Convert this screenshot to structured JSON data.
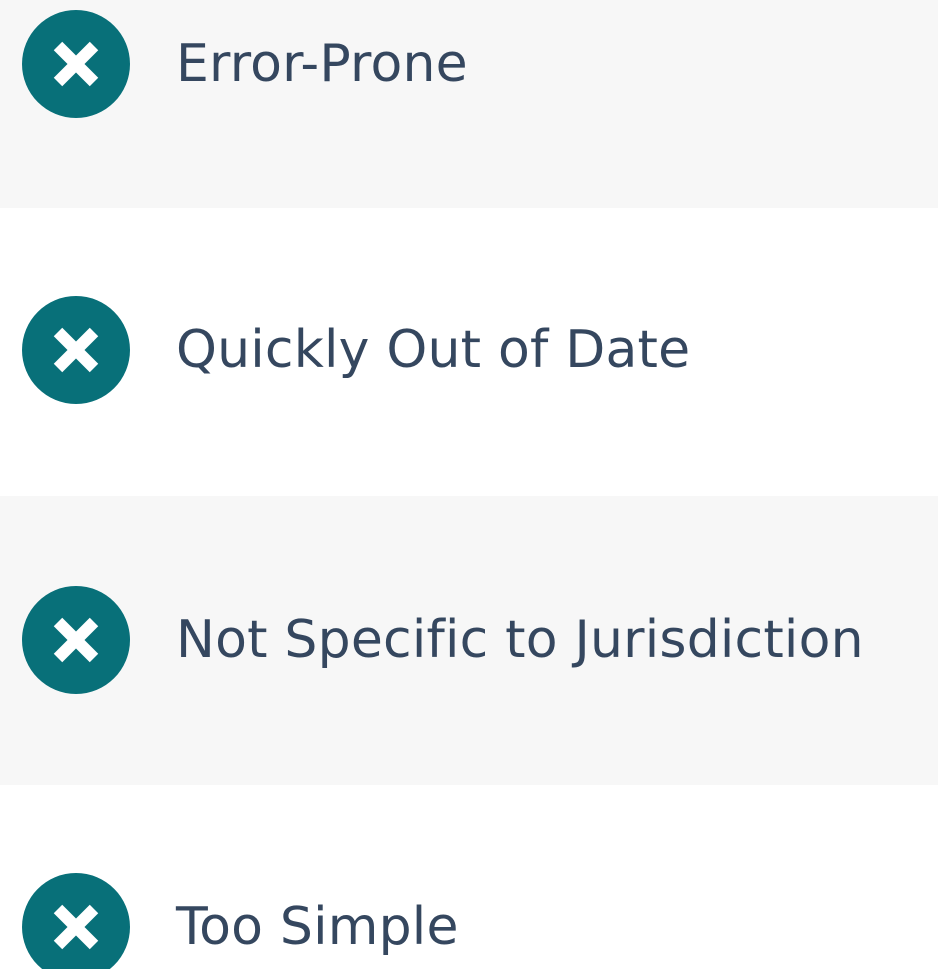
{
  "colors": {
    "icon_fill": "#087079",
    "icon_mark": "#ffffff",
    "text": "#35475f",
    "row_shaded": "#f7f7f7",
    "row_plain": "#ffffff"
  },
  "items": [
    {
      "icon": "x-circle-icon",
      "label": "Error-Prone"
    },
    {
      "icon": "x-circle-icon",
      "label": "Quickly Out of Date"
    },
    {
      "icon": "x-circle-icon",
      "label": "Not Specific to Jurisdiction"
    },
    {
      "icon": "x-circle-icon",
      "label": "Too Simple"
    }
  ]
}
